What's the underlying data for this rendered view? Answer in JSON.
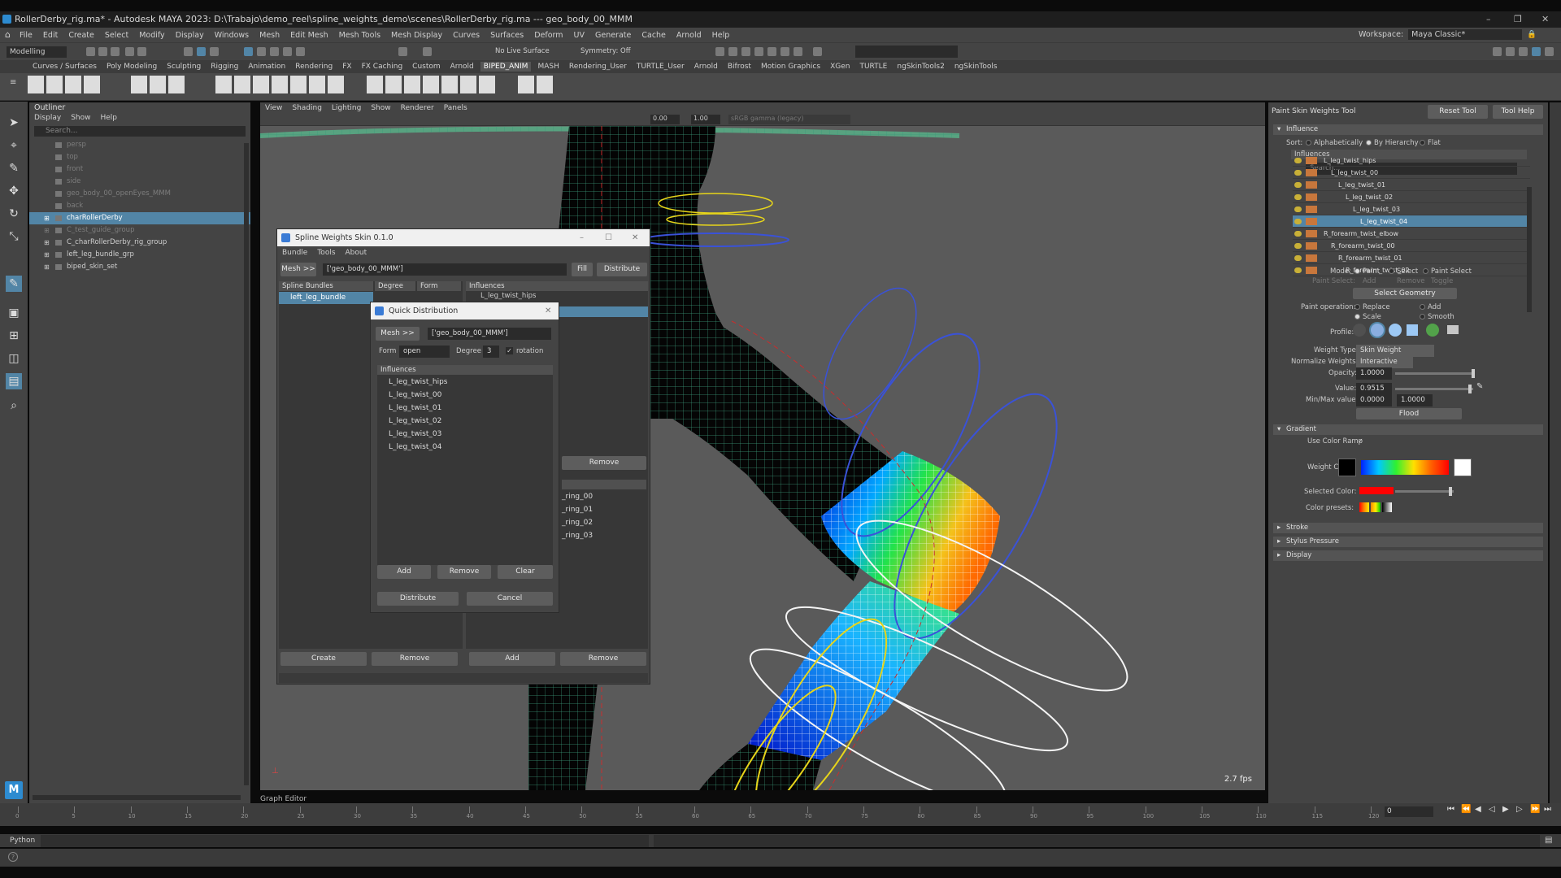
{
  "app": {
    "title": "RollerDerby_rig.ma* - Autodesk MAYA 2023: D:\\Trabajo\\demo_reel\\spline_weights_demo\\scenes\\RollerDerby_rig.ma  ---  geo_body_00_MMM",
    "menus": [
      "File",
      "Edit",
      "Create",
      "Select",
      "Modify",
      "Display",
      "Windows",
      "Mesh",
      "Edit Mesh",
      "Mesh Tools",
      "Mesh Display",
      "Curves",
      "Surfaces",
      "Deform",
      "UV",
      "Generate",
      "Cache",
      "Arnold",
      "Help"
    ],
    "workspace_label": "Workspace:",
    "workspace_value": "Maya Classic*",
    "mode": "Modelling",
    "live_surface": "No Live Surface",
    "symmetry": "Symmetry: Off"
  },
  "shelf": {
    "tabs": [
      "Curves / Surfaces",
      "Poly Modeling",
      "Sculpting",
      "Rigging",
      "Animation",
      "Rendering",
      "FX",
      "FX Caching",
      "Custom",
      "Arnold",
      "BIPED_ANIM",
      "MASH",
      "Rendering_User",
      "TURTLE_User",
      "Arnold",
      "Bifrost",
      "Motion Graphics",
      "XGen",
      "TURTLE",
      "ngSkinTools2",
      "ngSkinTools"
    ],
    "active_tab": "BIPED_ANIM"
  },
  "outliner": {
    "title": "Outliner",
    "menu": [
      "Display",
      "Show",
      "Help"
    ],
    "search_placeholder": "Search...",
    "items": [
      {
        "label": "persp",
        "dim": true,
        "selected": false,
        "expandable": false
      },
      {
        "label": "top",
        "dim": true,
        "selected": false,
        "expandable": false
      },
      {
        "label": "front",
        "dim": true,
        "selected": false,
        "expandable": false
      },
      {
        "label": "side",
        "dim": true,
        "selected": false,
        "expandable": false
      },
      {
        "label": "geo_body_00_openEyes_MMM",
        "dim": true,
        "selected": false,
        "expandable": false
      },
      {
        "label": "back",
        "dim": true,
        "selected": false,
        "expandable": false
      },
      {
        "label": "charRollerDerby",
        "dim": false,
        "selected": true,
        "expandable": true
      },
      {
        "label": "C_test_guide_group",
        "dim": true,
        "selected": false,
        "expandable": true
      },
      {
        "label": "C_charRollerDerby_rig_group",
        "dim": false,
        "selected": false,
        "expandable": true
      },
      {
        "label": "left_leg_bundle_grp",
        "dim": false,
        "selected": false,
        "expandable": true
      },
      {
        "label": "biped_skin_set",
        "dim": false,
        "selected": false,
        "expandable": true
      }
    ]
  },
  "viewport": {
    "menu": [
      "View",
      "Shading",
      "Lighting",
      "Show",
      "Renderer",
      "Panels"
    ],
    "field_a": "0.00",
    "field_b": "1.00",
    "color_space": "sRGB gamma (legacy)",
    "fps": "2.7 fps",
    "graph_editor": "Graph Editor"
  },
  "spline_window": {
    "title": "Spline Weights Skin 0.1.0",
    "menu": [
      "Bundle",
      "Tools",
      "About"
    ],
    "mesh_btn": "Mesh >>",
    "mesh_field": "['geo_body_00_MMM']",
    "fill_btn": "Fill",
    "distribute_btn": "Distribute",
    "col_bundles": "Spline Bundles",
    "col_degree": "Degree",
    "col_form": "Form",
    "col_influences": "Influences",
    "bundle_name": "left_leg_bundle",
    "first_influence": "L_leg_twist_hips",
    "remove_btn": "Remove",
    "rings": [
      "_ring_00",
      "_ring_01",
      "_ring_02",
      "_ring_03"
    ],
    "create_btn": "Create",
    "remove_btn2": "Remove",
    "add_btn": "Add",
    "remove_btn3": "Remove"
  },
  "quick_dist": {
    "title": "Quick Distribution",
    "mesh_btn": "Mesh >>",
    "mesh_field": "['geo_body_00_MMM']",
    "form_label": "Form",
    "form_value": "open",
    "degree_label": "Degree",
    "degree_value": "3",
    "rotation_label": "rotation",
    "influences_header": "Influences",
    "influences": [
      "L_leg_twist_hips",
      "L_leg_twist_00",
      "L_leg_twist_01",
      "L_leg_twist_02",
      "L_leg_twist_03",
      "L_leg_twist_04"
    ],
    "add_btn": "Add",
    "remove_btn": "Remove",
    "clear_btn": "Clear",
    "distribute_btn": "Distribute",
    "cancel_btn": "Cancel"
  },
  "attr": {
    "tool_title": "Paint Skin Weights Tool",
    "reset_btn": "Reset Tool",
    "help_btn": "Tool Help",
    "influence_section": "Influence",
    "sort_label": "Sort:",
    "sort_options": [
      "Alphabetically",
      "By Hierarchy",
      "Flat"
    ],
    "influences_label": "Influences",
    "search_placeholder": "Search...",
    "influence_list": [
      {
        "label": "L_leg_twist_hips",
        "indent": 0,
        "selected": false
      },
      {
        "label": "L_leg_twist_00",
        "indent": 1,
        "selected": false
      },
      {
        "label": "L_leg_twist_01",
        "indent": 2,
        "selected": false
      },
      {
        "label": "L_leg_twist_02",
        "indent": 3,
        "selected": false
      },
      {
        "label": "L_leg_twist_03",
        "indent": 4,
        "selected": false
      },
      {
        "label": "L_leg_twist_04",
        "indent": 5,
        "selected": true
      },
      {
        "label": "R_forearm_twist_elbow",
        "indent": 0,
        "selected": false
      },
      {
        "label": "R_forearm_twist_00",
        "indent": 1,
        "selected": false
      },
      {
        "label": "R_forearm_twist_01",
        "indent": 2,
        "selected": false
      },
      {
        "label": "R_forearm_twist_02",
        "indent": 3,
        "selected": false
      }
    ],
    "mode_label": "Mode:",
    "mode_options": [
      "Paint",
      "Select",
      "Paint Select"
    ],
    "paint_select_label": "Paint Select:",
    "paint_select_options": [
      "Add",
      "Remove",
      "Toggle"
    ],
    "select_geometry_btn": "Select Geometry",
    "paint_op_label": "Paint operation:",
    "paint_ops": [
      "Replace",
      "Add",
      "Scale",
      "Smooth"
    ],
    "profile_label": "Profile:",
    "weight_type_label": "Weight Type:",
    "weight_type_value": "Skin Weight",
    "normalize_label": "Normalize Weights:",
    "normalize_value": "Interactive",
    "opacity_label": "Opacity:",
    "opacity_value": "1.0000",
    "value_label": "Value:",
    "value_value": "0.9515",
    "minmax_label": "Min/Max value:",
    "min_value": "0.0000",
    "max_value": "1.0000",
    "flood_btn": "Flood",
    "gradient_section": "Gradient",
    "use_color_ramp": "Use Color Ramp",
    "weight_color_label": "Weight Color:",
    "selected_color_label": "Selected Color:",
    "color_presets_label": "Color presets:",
    "stroke_section": "Stroke",
    "stylus_section": "Stylus Pressure",
    "display_section": "Display"
  },
  "timeline": {
    "ticks": [
      "0",
      "5",
      "10",
      "15",
      "20",
      "25",
      "30",
      "35",
      "40",
      "45",
      "50",
      "55",
      "60",
      "65",
      "70",
      "75",
      "80",
      "85",
      "90",
      "95",
      "100",
      "105",
      "110",
      "115",
      "120"
    ],
    "current_frame": "0"
  },
  "cmdline": {
    "label": "Python"
  },
  "colors": {
    "selection": "#5285a6",
    "panel": "#444444",
    "viewport": "#5a5a5a"
  }
}
